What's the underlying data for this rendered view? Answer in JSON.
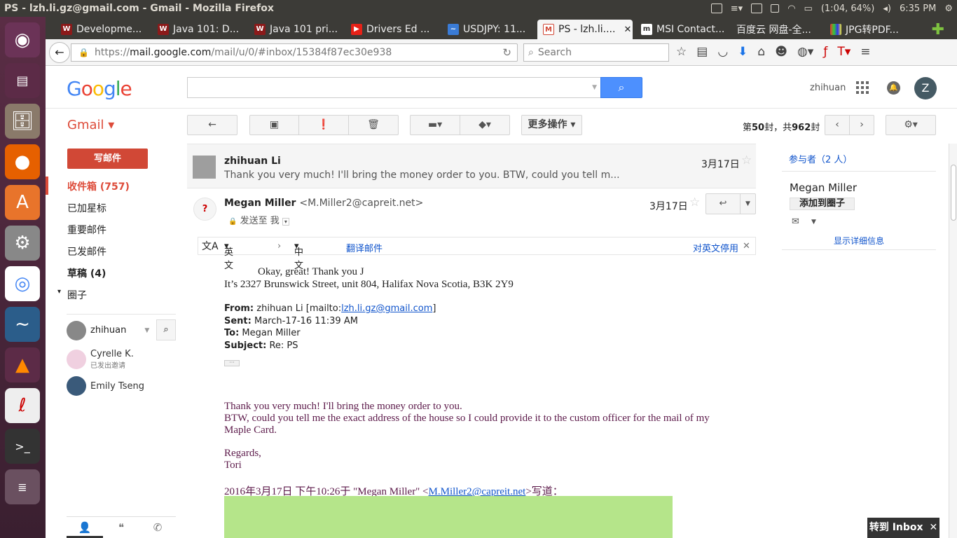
{
  "os": {
    "window_title": "PS - lzh.li.gz@gmail.com - Gmail - Mozilla Firefox",
    "battery": "(1:04, 64%)",
    "clock": "6:35 PM"
  },
  "browser": {
    "tabs": [
      {
        "label": "Developme...",
        "favicon": "W"
      },
      {
        "label": "Java 101: D...",
        "favicon": "W"
      },
      {
        "label": "Java 101 pri...",
        "favicon": "W"
      },
      {
        "label": "Drivers Ed ...",
        "favicon": "▶"
      },
      {
        "label": "USDJPY: 11...",
        "favicon": "~"
      },
      {
        "label": "PS - lzh.li....",
        "favicon": "M"
      },
      {
        "label": "MSI Contact...",
        "favicon": "m"
      },
      {
        "label": "百度云 网盘-全...",
        "favicon": ""
      },
      {
        "label": "JPG转PDF...",
        "favicon": ""
      }
    ],
    "url": "https://mail.google.com/mail/u/0/#inbox/15384f87ec30e938",
    "url_host": "mail.google.com",
    "url_prefix": "https://",
    "url_path": "/mail/u/0/#inbox/15384f87ec30e938",
    "search_placeholder": "Search"
  },
  "gmail": {
    "logo_letters": [
      "G",
      "o",
      "o",
      "g",
      "l",
      "e"
    ],
    "user_name": "zhihuan",
    "avatar_letter": "Z",
    "gmail_label": "Gmail ▾",
    "more_actions": "更多操作 ▾",
    "page_count_prefix": "第",
    "page_count_current": "50",
    "page_count_mid": "封，共",
    "page_count_total": "962",
    "page_count_suffix": "封"
  },
  "sidebar": {
    "compose": "写邮件",
    "items": [
      {
        "label": "收件箱 (757)"
      },
      {
        "label": "已加星标"
      },
      {
        "label": "重要邮件"
      },
      {
        "label": "已发邮件"
      },
      {
        "label": "草稿 (4)"
      },
      {
        "label": "圈子"
      }
    ],
    "circles_caret": "▾",
    "hangouts_user": "zhihuan",
    "contacts": [
      {
        "name": "Cyrelle K.",
        "status": "已发出邀请"
      },
      {
        "name": "Emily Tseng",
        "status": ""
      }
    ]
  },
  "thread": {
    "collapsed": {
      "sender": "zhihuan Li",
      "snippet": "Thank you very much! I'll bring the money order to you. BTW, could you tell m...",
      "date": "3月17日"
    },
    "expanded": {
      "sender": "Megan Miller",
      "sender_email": "<M.Miller2@capreit.net>",
      "to_line": "发送至 我",
      "date": "3月17日"
    },
    "translate": {
      "from_lang": "英文",
      "to_lang": "中文",
      "action": "翻译邮件",
      "disable": "对英文停用"
    },
    "body": {
      "line1": "Okay, great! Thank you J",
      "line2": "It’s 2327 Brunswick Street, unit 804, Halifax Nova Scotia, B3K 2Y9",
      "from_label": "From:",
      "from_name": "zhihuan Li [mailto:",
      "from_email": "lzh.li.gz@gmail.com",
      "from_end": "]",
      "sent_label": "Sent:",
      "sent_value": "March-17-16 11:39 AM",
      "to_label": "To:",
      "to_value": "Megan Miller",
      "subject_label": "Subject:",
      "subject_value": "Re: PS",
      "ellipsis": "···",
      "quoted1": "Thank you very much! I'll bring the money order to you.",
      "quoted2": "BTW, could you tell me the exact address of the house so I could provide it to the custom officer for the mail of my",
      "quoted3": "Maple Card.",
      "regards": "Regards,",
      "signature": "Tori",
      "wrote_prefix": "2016年3月17日 下午10:26于 \"Megan Miller\" <",
      "wrote_email": "M.Miller2@capreit.net",
      "wrote_suffix": ">写道："
    }
  },
  "right_panel": {
    "participants": "参与者（2 人）",
    "name": "Megan Miller",
    "add_to_circles": "添加到圈子",
    "details": "显示详细信息"
  },
  "toast": {
    "label": "转到 Inbox",
    "close": "✕"
  },
  "colors": {
    "gmail_red": "#dd4b39",
    "compose": "#d14836",
    "search_blue": "#4d90fe",
    "quoted_purple": "#5c1a4a",
    "link": "#1155cc",
    "image_green": "#b5e58a"
  }
}
